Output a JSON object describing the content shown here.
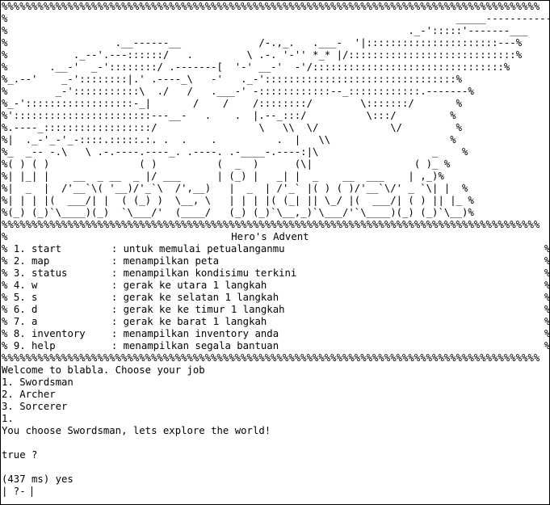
{
  "banner": {
    "border": "%%%%%%%%%%%%%%%%%%%%%%%%%%%%%%%%%%%%%%%%%%%%%%%%%%%%%%%%%%%%%%%%%%%%%%%%%%%%%%%%%%%%%%%%%%",
    "art": [
      "%                                                                           _____-----------____ %",
      "%                                                                   ._-':::::'-------___        %",
      "%                  .__------__             /-.,_.   .___-  '|::::::::::::::::::::::---%",
      "%           ._--'.---::::::/   .         \\ .-. '-'' *_* |/::::::::::::::::::::::::::::%",
      "%       .__-'  _-'::::::::/ .-------[  '-' __-'  -'/::::::::::::::::::::::::::::::::%",
      "%_.--'    _-'::::::::|.' .----_\\   -'   ._-'::::::::::::::::::::::::::::::::%",
      "%        _-':::::::::::\\  ./   /   .___-' -::::::::::::--_::::::::::::.-------%",
      "%_-'::::::::::::::::::-_|       /    /    /::::::::/        \\:::::::/       %",
      "%':::::::::::::::::::::::---__-   .    .  |.--_:::/          \\:::/         %",
      "%.----_::::::::::::::::::/                 \\   \\\\  \\/            \\/         %",
      "%|  ._-'_-'_-::::.:::::.:. .  .    .          .  |   \\\\                    %",
      "%_  _-- -.\\   \\ .-.----.----_. .----. .-____-.----:|\\                   _    %",
      "%( ) ( )               ( )          (  _  )      (\\|                 ( )_ %",
      "%| |_| |    __  _ __  _ |/ ___      | (_) |   _| |  _    __  ___    | ,_)%",
      "%|  _  |  /'__`\\( '__)/'_`\\  /',__)   |  _  | /'_` |( ) ( )/'__`\\/' _ `\\| |  %",
      "%| | | |(  ___/| |  ( (_) )  \\__, \\   | | | |( (_| || \\_/ |(  ___/| ( ) || |_ %",
      "%(_) (_)`\\____)(_)  `\\___/'  (____/   (_) (_)`\\__,_)`\\___/'`\\____)(_) (_)`\\__)%"
    ],
    "title": "Hero's Advent",
    "commands": [
      {
        "key": "1. start",
        "desc": ": untuk memulai petualanganmu"
      },
      {
        "key": "2. map",
        "desc": ": menampilkan peta"
      },
      {
        "key": "3. status",
        "desc": ": menampilkan kondisimu terkini"
      },
      {
        "key": "4. w",
        "desc": ": gerak ke utara 1 langkah"
      },
      {
        "key": "5. s",
        "desc": ": gerak ke selatan 1 langkah"
      },
      {
        "key": "6. d",
        "desc": ": gerak ke ke timur 1 langkah"
      },
      {
        "key": "7. a",
        "desc": ": gerak ke barat 1 langkah"
      },
      {
        "key": "8. inventory",
        "desc": ": menampilkan inventory anda"
      },
      {
        "key": "9. help",
        "desc": ": menampilkan segala bantuan"
      }
    ]
  },
  "console": {
    "welcome": "Welcome to blabla. Choose your job",
    "jobs": [
      "1. Swordsman",
      "2. Archer",
      "3. Sorcerer"
    ],
    "user_choice": "1.",
    "result": "You choose Swordsman, lets explore the world!",
    "query": "true ?",
    "answer": "(437 ms) yes",
    "prompt": "| ?- "
  }
}
